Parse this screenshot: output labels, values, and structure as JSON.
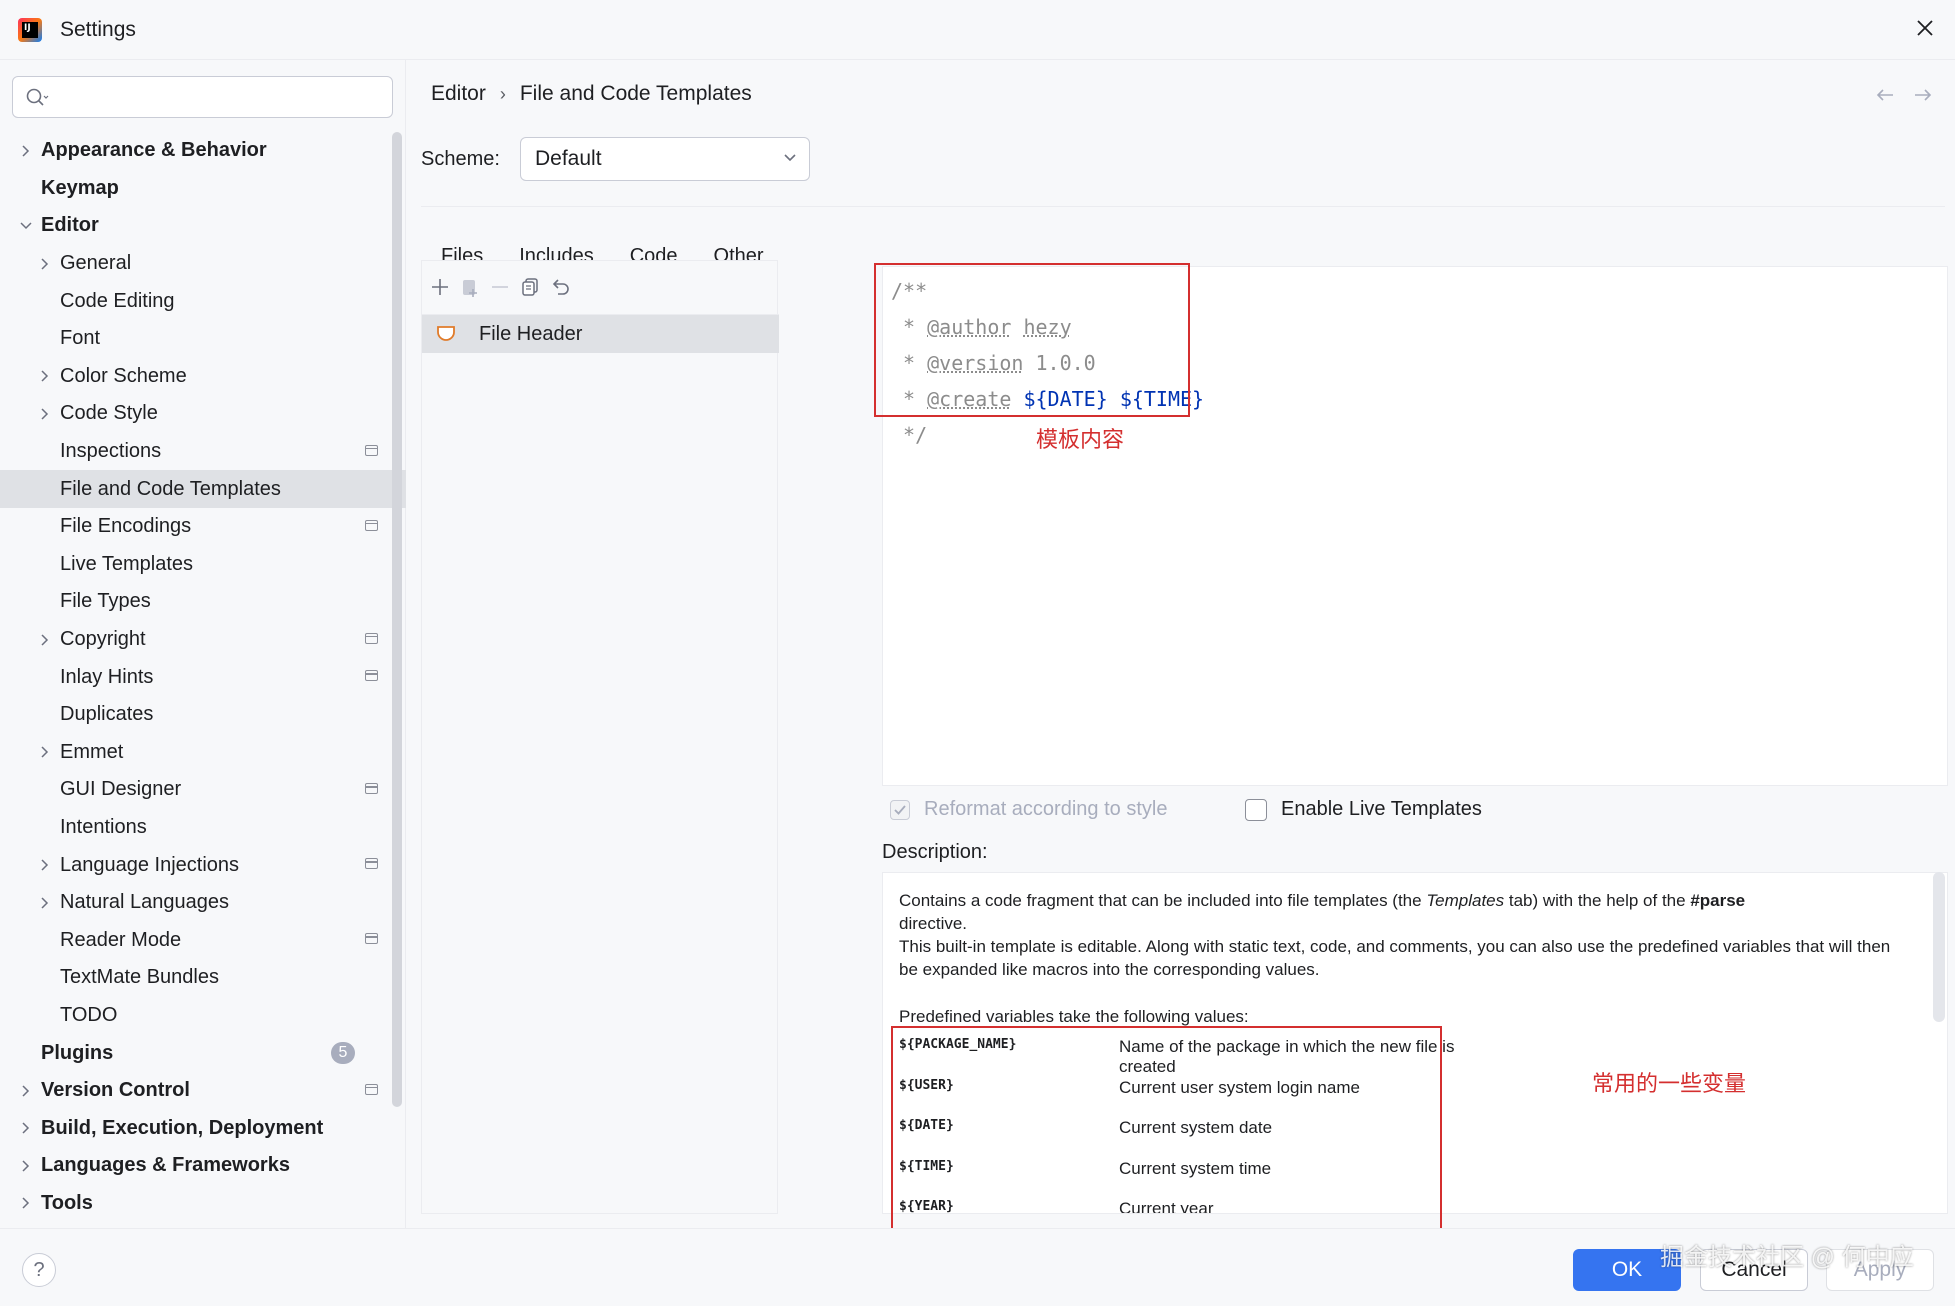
{
  "window": {
    "title": "Settings"
  },
  "search": {
    "placeholder": ""
  },
  "sidebar": {
    "items": [
      {
        "label": "Appearance & Behavior",
        "level": 0,
        "chevron": "right",
        "bold": true,
        "project": false
      },
      {
        "label": "Keymap",
        "level": 0,
        "chevron": "none",
        "bold": true,
        "project": false
      },
      {
        "label": "Editor",
        "level": 0,
        "chevron": "down",
        "bold": true,
        "project": false
      },
      {
        "label": "General",
        "level": 1,
        "chevron": "right",
        "bold": false,
        "project": false
      },
      {
        "label": "Code Editing",
        "level": 1,
        "chevron": "none",
        "bold": false,
        "project": false
      },
      {
        "label": "Font",
        "level": 1,
        "chevron": "none",
        "bold": false,
        "project": false
      },
      {
        "label": "Color Scheme",
        "level": 1,
        "chevron": "right",
        "bold": false,
        "project": false
      },
      {
        "label": "Code Style",
        "level": 1,
        "chevron": "right",
        "bold": false,
        "project": false
      },
      {
        "label": "Inspections",
        "level": 1,
        "chevron": "none",
        "bold": false,
        "project": true
      },
      {
        "label": "File and Code Templates",
        "level": 1,
        "chevron": "none",
        "bold": false,
        "project": false,
        "selected": true
      },
      {
        "label": "File Encodings",
        "level": 1,
        "chevron": "none",
        "bold": false,
        "project": true
      },
      {
        "label": "Live Templates",
        "level": 1,
        "chevron": "none",
        "bold": false,
        "project": false
      },
      {
        "label": "File Types",
        "level": 1,
        "chevron": "none",
        "bold": false,
        "project": false
      },
      {
        "label": "Copyright",
        "level": 1,
        "chevron": "right",
        "bold": false,
        "project": true
      },
      {
        "label": "Inlay Hints",
        "level": 1,
        "chevron": "none",
        "bold": false,
        "project": true
      },
      {
        "label": "Duplicates",
        "level": 1,
        "chevron": "none",
        "bold": false,
        "project": false
      },
      {
        "label": "Emmet",
        "level": 1,
        "chevron": "right",
        "bold": false,
        "project": false
      },
      {
        "label": "GUI Designer",
        "level": 1,
        "chevron": "none",
        "bold": false,
        "project": true
      },
      {
        "label": "Intentions",
        "level": 1,
        "chevron": "none",
        "bold": false,
        "project": false
      },
      {
        "label": "Language Injections",
        "level": 1,
        "chevron": "right",
        "bold": false,
        "project": true
      },
      {
        "label": "Natural Languages",
        "level": 1,
        "chevron": "right",
        "bold": false,
        "project": false
      },
      {
        "label": "Reader Mode",
        "level": 1,
        "chevron": "none",
        "bold": false,
        "project": true
      },
      {
        "label": "TextMate Bundles",
        "level": 1,
        "chevron": "none",
        "bold": false,
        "project": false
      },
      {
        "label": "TODO",
        "level": 1,
        "chevron": "none",
        "bold": false,
        "project": false
      },
      {
        "label": "Plugins",
        "level": 0,
        "chevron": "none",
        "bold": true,
        "project": false,
        "badge": "5"
      },
      {
        "label": "Version Control",
        "level": 0,
        "chevron": "right",
        "bold": true,
        "project": true
      },
      {
        "label": "Build, Execution, Deployment",
        "level": 0,
        "chevron": "right",
        "bold": true,
        "project": false
      },
      {
        "label": "Languages & Frameworks",
        "level": 0,
        "chevron": "right",
        "bold": true,
        "project": false
      },
      {
        "label": "Tools",
        "level": 0,
        "chevron": "right",
        "bold": true,
        "project": false
      }
    ]
  },
  "breadcrumb": {
    "parent": "Editor",
    "separator": "›",
    "current": "File and Code Templates"
  },
  "scheme": {
    "label": "Scheme:",
    "value": "Default"
  },
  "tabs": [
    {
      "label": "Files",
      "active": false
    },
    {
      "label": "Includes",
      "active": true
    },
    {
      "label": "Code",
      "active": false
    },
    {
      "label": "Other",
      "active": false
    }
  ],
  "template_list": {
    "items": [
      {
        "label": "File Header",
        "selected": true
      }
    ]
  },
  "editor": {
    "lines": [
      {
        "prefix": "/**"
      },
      {
        "prefix": " * ",
        "tag": "@author",
        "rest": " ",
        "tagval": "hezy"
      },
      {
        "prefix": " * ",
        "tag": "@version",
        "rest": " 1.0.0"
      },
      {
        "prefix": " * ",
        "tag": "@create",
        "rest": " ",
        "var1": "${DATE}",
        "sp": " ",
        "var2": "${TIME}"
      },
      {
        "prefix": " */"
      }
    ]
  },
  "annotations": {
    "template_content": "模板内容",
    "common_variables": "常用的一些变量"
  },
  "options": {
    "reformat": {
      "label": "Reformat according to style",
      "checked": true,
      "enabled": false
    },
    "live_templates": {
      "label": "Enable Live Templates",
      "checked": false,
      "enabled": true
    }
  },
  "description": {
    "label": "Description:",
    "intro_1": "Contains a code fragment that can be included into file templates (the ",
    "intro_italic": "Templates",
    "intro_2": " tab) with the help of the ",
    "intro_bold": "#parse",
    "intro_3": "directive.",
    "intro_4": "This built-in template is editable. Along with static text, code, and comments, you can also use the predefined variables that will then be expanded like macros into the corresponding values.",
    "predefined": "Predefined variables take the following values:",
    "variables": [
      {
        "name": "${PACKAGE_NAME}",
        "desc": "Name of the package in which the new file is created"
      },
      {
        "name": "${USER}",
        "desc": "Current user system login name"
      },
      {
        "name": "${DATE}",
        "desc": "Current system date"
      },
      {
        "name": "${TIME}",
        "desc": "Current system time"
      },
      {
        "name": "${YEAR}",
        "desc": "Current year"
      }
    ]
  },
  "footer": {
    "ok": "OK",
    "cancel": "Cancel",
    "apply": "Apply",
    "help": "?"
  },
  "watermark": "掘金技术社区 @ 何中应",
  "colors": {
    "accent": "#3574f0",
    "selection": "#dfe1e5",
    "annotation": "#d42f2f",
    "variable": "#0033b3"
  }
}
